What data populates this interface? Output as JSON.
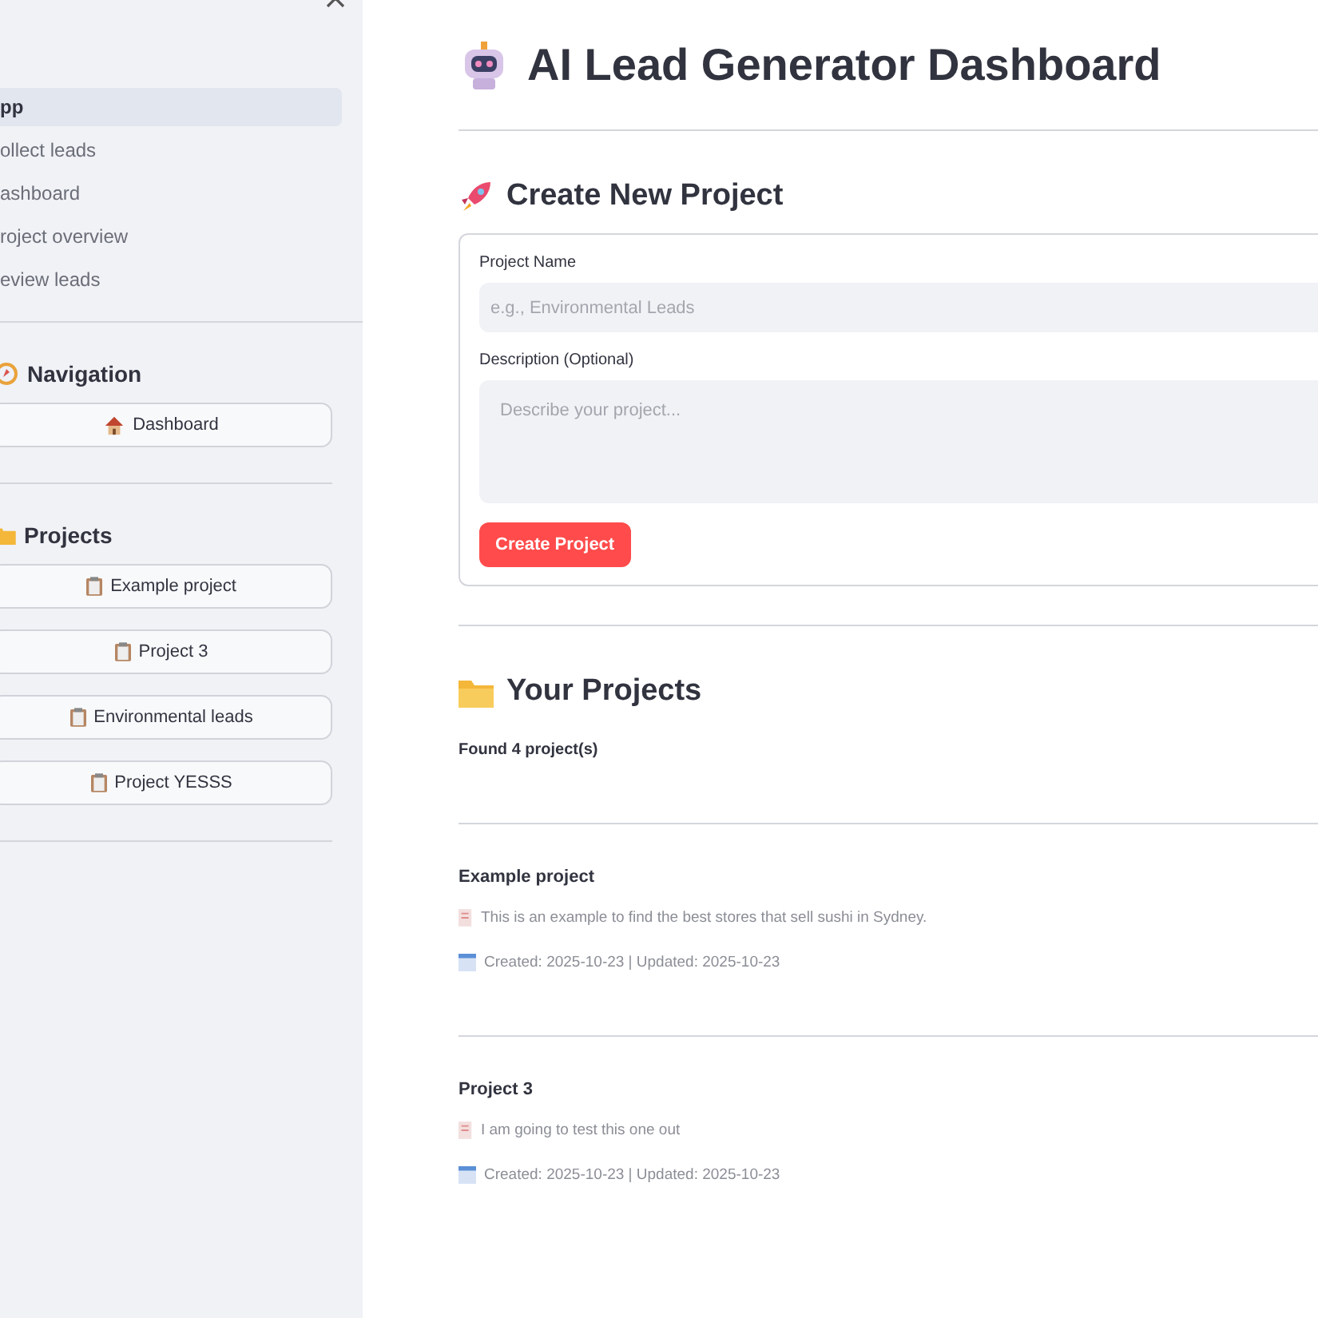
{
  "sidebar": {
    "nav_items": [
      {
        "label": "pp",
        "selected": true
      },
      {
        "label": "ollect leads",
        "selected": false
      },
      {
        "label": "ashboard",
        "selected": false
      },
      {
        "label": "roject overview",
        "selected": false
      },
      {
        "label": "eview leads",
        "selected": false
      }
    ],
    "navigation": {
      "title": "Navigation",
      "button": "Dashboard"
    },
    "projects": {
      "title": "Projects",
      "buttons": [
        "Example project",
        "Project 3",
        "Environmental leads",
        "Project YESSS"
      ]
    }
  },
  "main": {
    "title": "AI Lead Generator Dashboard",
    "create": {
      "title": "Create New Project",
      "name_label": "Project Name",
      "name_placeholder": "e.g., Environmental Leads",
      "desc_label": "Description (Optional)",
      "desc_placeholder": "Describe your project...",
      "submit": "Create Project"
    },
    "projects": {
      "title": "Your Projects",
      "count": "Found 4 project(s)",
      "items": [
        {
          "name": "Example project",
          "description": "This is an example to find the best stores that sell sushi in Sydney.",
          "dates": "Created: 2025-10-23 | Updated: 2025-10-23"
        },
        {
          "name": "Project 3",
          "description": "I am going to test this one out",
          "dates": "Created: 2025-10-23 | Updated: 2025-10-23"
        }
      ]
    }
  }
}
